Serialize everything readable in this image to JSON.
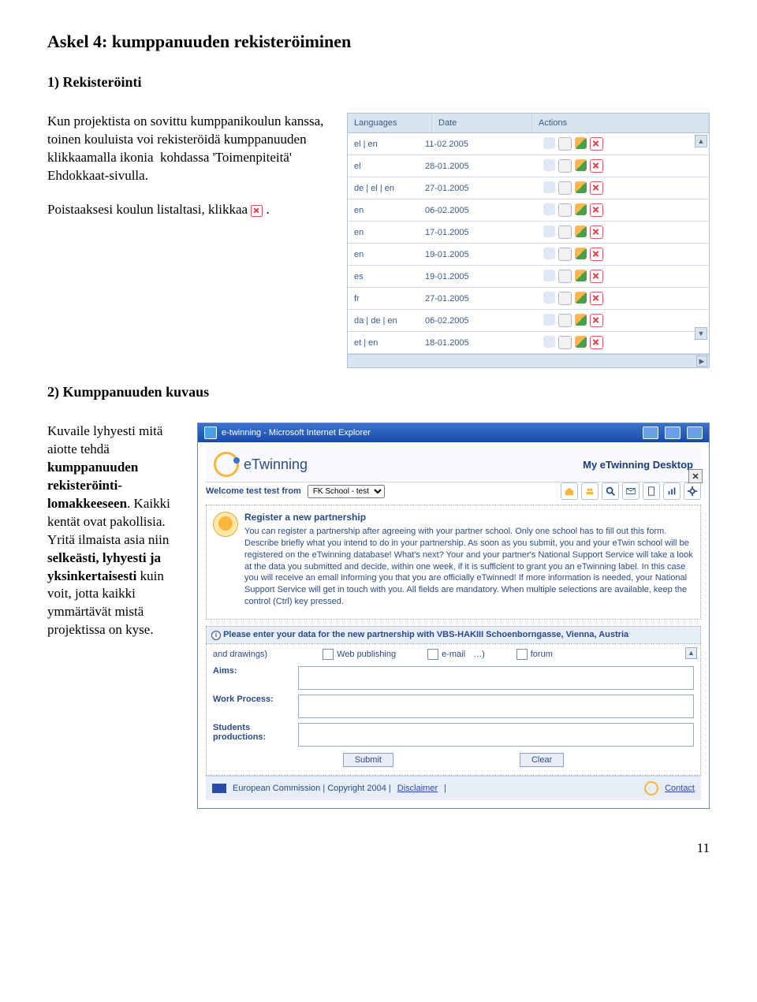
{
  "headings": {
    "main": "Askel 4: kumppanuuden rekisteröiminen",
    "sub1": "1) Rekisteröinti",
    "sub2": "2) Kumppanuuden kuvaus"
  },
  "intro": {
    "p1a": "Kun projektista on sovittu kumppanikoulun kanssa, toinen kouluista voi rekisteröidä kumppanuuden klikkaamalla ikonia",
    "p1b": " kohdassa 'Toimenpiteitä' Ehdokkaat-sivulla.",
    "p2a": "Poistaaksesi koulun listaltasi, klikkaa ",
    "p2b": "."
  },
  "table": {
    "headers": {
      "lang": "Languages",
      "date": "Date",
      "actions": "Actions"
    },
    "rows": [
      {
        "lang": "el | en",
        "date": "11-02.2005"
      },
      {
        "lang": "el",
        "date": "28-01.2005"
      },
      {
        "lang": "de | el | en",
        "date": "27-01.2005"
      },
      {
        "lang": "en",
        "date": "06-02.2005"
      },
      {
        "lang": "en",
        "date": "17-01.2005"
      },
      {
        "lang": "en",
        "date": "19-01.2005"
      },
      {
        "lang": "es",
        "date": "19-01.2005"
      },
      {
        "lang": "fr",
        "date": "27-01.2005"
      },
      {
        "lang": "da | de | en",
        "date": "06-02.2005"
      },
      {
        "lang": "et | en",
        "date": "18-01.2005"
      }
    ]
  },
  "desc2": {
    "t1": "Kuvaile lyhyesti mitä aiotte tehdä ",
    "b1": "kumppanuuden rekisteröinti-lomakkeeseen",
    "t2": ". Kaikki kentät ovat pakollisia. Yritä ilmaista asia niin ",
    "b2": "selkeästi, lyhyesti ja yksinkertaisesti",
    "t3": " kuin voit, jotta kaikki ymmärtävät mistä projektissa on kyse."
  },
  "ie": {
    "title": "e-twinning - Microsoft Internet Explorer",
    "brand": "eTwinning",
    "desktop": "My eTwinning Desktop",
    "welcome": "Welcome test test from",
    "school_selected": "FK School - test",
    "reg_title": "Register a new partnership",
    "reg_desc": "You can register a partnership after agreeing with your partner school. Only one school has to fill out this form. Describe briefly what you intend to do in your partnership. As soon as you submit, you and your eTwin school will be registered on the eTwinning database! What's next? Your and your partner's National Support Service will take a look at the data you submitted and decide, within one week, if it is sufficient to grant you an eTwinning label. In this case you will receive an email informing you that you are officially eTwinned! If more information is needed, your National Support Service will get in touch with you. All fields are mandatory. When multiple selections are available, keep the control (Ctrl) key pressed.",
    "form_head": "Please enter your data for the new partnership with VBS-HAKIII Schoenborngasse, Vienna, Austria",
    "opt_note": "and drawings)",
    "opt1": "Web publishing",
    "opt2": "e-mail",
    "opt3": "…)",
    "opt4": "forum",
    "f_aims": "Aims:",
    "f_work": "Work Process:",
    "f_stud": "Students productions:",
    "btn_submit": "Submit",
    "btn_clear": "Clear",
    "footer_text": "European Commission | Copyright 2004 |",
    "footer_disc": "Disclaimer",
    "footer_sep": " | ",
    "footer_contact": "Contact"
  },
  "page_number": "11"
}
